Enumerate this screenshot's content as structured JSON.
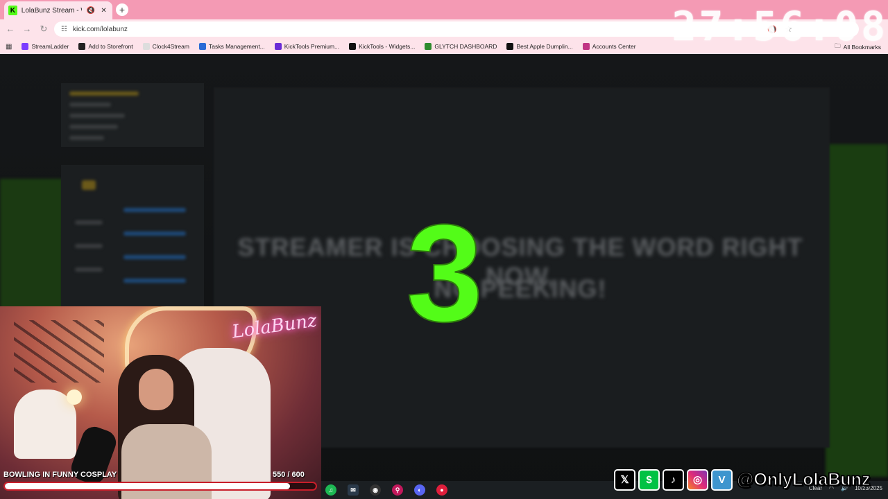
{
  "browser": {
    "tab_title": "LolaBunz Stream - Watch Li",
    "tab_favicon": "K",
    "new_tab_label": "+",
    "url": "kick.com/lolabunz",
    "bookmarks": [
      {
        "label": "StreamLadder",
        "color": "#7a3cff"
      },
      {
        "label": "Add to Storefront",
        "color": "#222222"
      },
      {
        "label": "Clock4Stream",
        "color": "#dddddd"
      },
      {
        "label": "Tasks Management...",
        "color": "#2a6bd6"
      },
      {
        "label": "KickTools Premium...",
        "color": "#6a2bd6"
      },
      {
        "label": "KickTools - Widgets...",
        "color": "#111111"
      },
      {
        "label": "GLYTCH DASHBOARD",
        "color": "#2e8b2e"
      },
      {
        "label": "Best Apple Dumplin...",
        "color": "#111111"
      },
      {
        "label": "Accounts Center",
        "color": "#c13584"
      }
    ],
    "all_bookmarks": "All Bookmarks"
  },
  "overlay": {
    "clock": "27:56:08",
    "countdown": "3",
    "message_line1": "STREAMER IS CHOOSING THE WORD RIGHT NOW,",
    "message_line2": "NO PEEKING!"
  },
  "goal": {
    "label": "BOWLING IN FUNNY COSPLAY",
    "count": "550 / 600",
    "progress": 0.9167
  },
  "webcam": {
    "neon_sign": "LolaBunz"
  },
  "social": {
    "icons": [
      {
        "name": "x-icon",
        "glyph": "𝕏"
      },
      {
        "name": "cashapp-icon",
        "glyph": "$"
      },
      {
        "name": "tiktok-icon",
        "glyph": "♪"
      },
      {
        "name": "instagram-icon",
        "glyph": "◎"
      },
      {
        "name": "venmo-icon",
        "glyph": "V"
      }
    ],
    "handle": "@OnlyLolaBunz"
  },
  "taskbar": {
    "weather": "Clear",
    "date": "10/23/2025"
  }
}
